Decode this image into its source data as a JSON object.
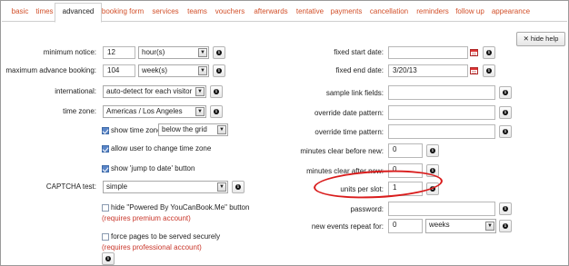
{
  "tabs": [
    {
      "label": "basic"
    },
    {
      "label": "times"
    },
    {
      "label": "advanced"
    },
    {
      "label": "booking form"
    },
    {
      "label": "services"
    },
    {
      "label": "teams"
    },
    {
      "label": "vouchers"
    },
    {
      "label": "afterwards"
    },
    {
      "label": "tentative"
    },
    {
      "label": "payments"
    },
    {
      "label": "cancellation"
    },
    {
      "label": "reminders"
    },
    {
      "label": "follow up"
    },
    {
      "label": "appearance"
    }
  ],
  "active_tab": "advanced",
  "help_button": {
    "icon": "close-x",
    "label": "hide help"
  },
  "left": {
    "minimum_notice": {
      "label": "minimum notice:",
      "value": "12",
      "unit": "hour(s)"
    },
    "max_advance": {
      "label": "maximum advance booking:",
      "value": "104",
      "unit": "week(s)"
    },
    "international": {
      "label": "international:",
      "value": "auto-detect for each visitor"
    },
    "time_zone": {
      "label": "time zone:",
      "value": "Americas / Los Angeles"
    },
    "show_time_zone": {
      "label": "show time zone",
      "checked": true,
      "position": "below the grid"
    },
    "allow_change_tz": {
      "label": "allow user to change time zone",
      "checked": true
    },
    "show_jump": {
      "label": "show 'jump to date' button",
      "checked": true
    },
    "captcha": {
      "label": "CAPTCHA test:",
      "value": "simple"
    },
    "hide_powered": {
      "label": "hide \"Powered By YouCanBook.Me\" button",
      "checked": false,
      "note": "(requires premium account)"
    },
    "force_secure": {
      "label": "force pages to be served securely",
      "checked": false,
      "note": "(requires professional account)"
    }
  },
  "right": {
    "fixed_start": {
      "label": "fixed start date:",
      "value": ""
    },
    "fixed_end": {
      "label": "fixed end date:",
      "value": "3/20/13"
    },
    "sample_link": {
      "label": "sample link fields:",
      "value": ""
    },
    "override_date": {
      "label": "override date pattern:",
      "value": ""
    },
    "override_time": {
      "label": "override time pattern:",
      "value": ""
    },
    "clear_before": {
      "label": "minutes clear before new:",
      "value": "0"
    },
    "clear_after": {
      "label": "minutes clear after new:",
      "value": "0"
    },
    "units_per_slot": {
      "label": "units per slot:",
      "value": "1",
      "highlight_color": "#d91c1c"
    },
    "password": {
      "label": "password:",
      "value": ""
    },
    "repeat_for": {
      "label": "new events repeat for:",
      "value": "0",
      "unit": "weeks"
    }
  },
  "colors": {
    "tab_link": "#d2502a",
    "warning": "#c9362a",
    "checkbox": "#5b86c8",
    "highlight": "#d91c1c"
  }
}
